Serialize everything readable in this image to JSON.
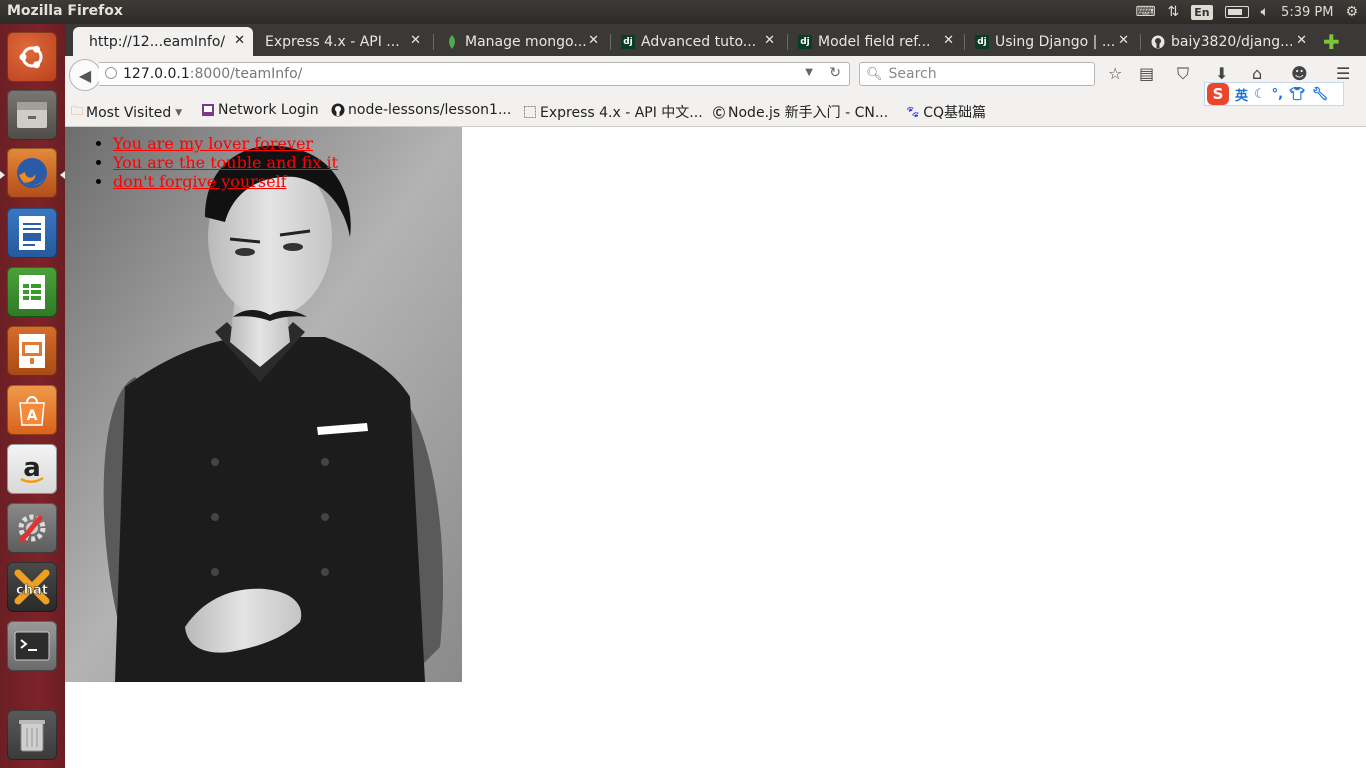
{
  "window": {
    "title": "Mozilla Firefox"
  },
  "system_tray": {
    "lang": "En",
    "time": "5:39 PM"
  },
  "launcher": {
    "items": [
      "ubuntu-dash",
      "files",
      "firefox",
      "libreoffice-writer",
      "libreoffice-calc",
      "libreoffice-impress",
      "ubuntu-software-center",
      "amazon",
      "system-settings",
      "xchat",
      "terminal",
      "trash"
    ]
  },
  "tabs": [
    {
      "title": "http://12...eamInfo/",
      "favicon": "",
      "active": true
    },
    {
      "title": "Express 4.x - API ...",
      "favicon": "",
      "active": false
    },
    {
      "title": "Manage mongo...",
      "favicon": "mongodb-leaf",
      "active": false
    },
    {
      "title": "Advanced tuto...",
      "favicon": "dj",
      "active": false
    },
    {
      "title": "Model field ref...",
      "favicon": "dj",
      "active": false
    },
    {
      "title": "Using Django | ...",
      "favicon": "dj",
      "active": false
    },
    {
      "title": "baiy3820/djang...",
      "favicon": "github",
      "active": false
    }
  ],
  "navbar": {
    "url_host": "127.0.0.1",
    "url_rest": ":8000/teamInfo/",
    "search_placeholder": "Search"
  },
  "bookmarks": [
    {
      "label": "Most Visited",
      "icon": "folder",
      "dropdown": true
    },
    {
      "label": "Network Login",
      "icon": "page"
    },
    {
      "label": "node-lessons/lesson1...",
      "icon": "github"
    },
    {
      "label": "Express 4.x - API 中文...",
      "icon": "blank"
    },
    {
      "label": "Node.js 新手入门 - CN...",
      "icon": "cnode"
    },
    {
      "label": "CQ基础篇",
      "icon": "baidu-paw"
    }
  ],
  "ime": {
    "logo": "S",
    "mode": "英",
    "items": [
      "moon",
      "dot",
      "shirt",
      "wrench"
    ]
  },
  "page": {
    "links": [
      "You are my lover forever",
      "You are the touble and fix it",
      "don't forgive yourself"
    ]
  }
}
